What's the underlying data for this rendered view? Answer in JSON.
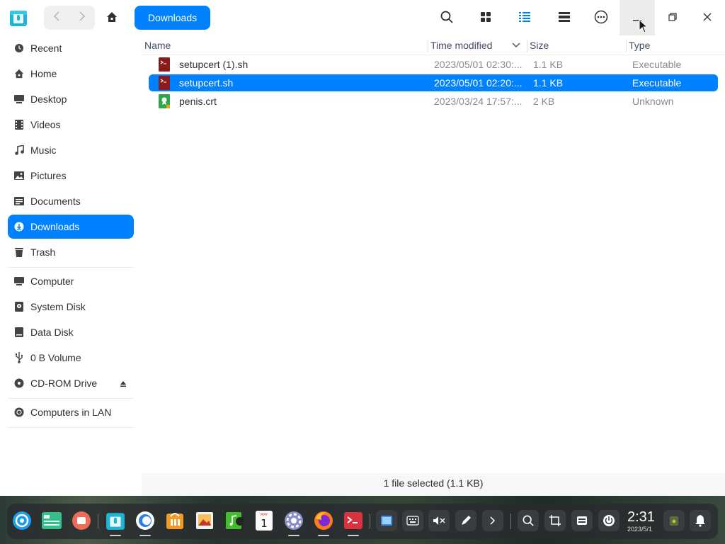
{
  "window": {
    "title_crumb": "Downloads",
    "icons": {
      "back": "chevron-left-icon",
      "forward": "chevron-right-icon",
      "home": "home-icon",
      "search": "search-icon",
      "icon_view": "grid-view-icon",
      "list_view": "list-view-icon",
      "detail_view": "detail-view-icon",
      "more": "more-icon",
      "minimize": "minimize-icon",
      "maximize": "maximize-icon",
      "close": "close-icon"
    }
  },
  "sidebar": {
    "items": [
      {
        "label": "Recent",
        "icon": "clock-icon"
      },
      {
        "label": "Home",
        "icon": "home-icon"
      },
      {
        "label": "Desktop",
        "icon": "desktop-icon"
      },
      {
        "label": "Videos",
        "icon": "video-icon"
      },
      {
        "label": "Music",
        "icon": "music-icon"
      },
      {
        "label": "Pictures",
        "icon": "picture-icon"
      },
      {
        "label": "Documents",
        "icon": "document-icon"
      },
      {
        "label": "Downloads",
        "icon": "download-icon",
        "active": true
      },
      {
        "label": "Trash",
        "icon": "trash-icon"
      }
    ],
    "devices": [
      {
        "label": "Computer",
        "icon": "computer-icon"
      },
      {
        "label": "System Disk",
        "icon": "disk-icon"
      },
      {
        "label": "Data Disk",
        "icon": "disk-icon"
      },
      {
        "label": "0 B Volume",
        "icon": "usb-icon"
      },
      {
        "label": "CD-ROM Drive",
        "icon": "cdrom-icon",
        "eject": true
      }
    ],
    "network": [
      {
        "label": "Computers in LAN",
        "icon": "network-icon"
      }
    ]
  },
  "file_list": {
    "columns": [
      "Name",
      "Time modified",
      "Size",
      "Type"
    ],
    "rows": [
      {
        "name": "setupcert (1).sh",
        "time": "2023/05/01 02:30:...",
        "size": "1.1 KB",
        "type": "Executable",
        "icon": "script-file-icon",
        "selected": false
      },
      {
        "name": "setupcert.sh",
        "time": "2023/05/01 02:20:...",
        "size": "1.1 KB",
        "type": "Executable",
        "icon": "script-file-icon",
        "selected": true
      },
      {
        "name": "penis.crt",
        "time": "2023/03/24 17:57:...",
        "size": "2 KB",
        "type": "Unknown",
        "icon": "certificate-file-icon",
        "selected": false
      }
    ]
  },
  "status_bar": {
    "text": "1 file selected (1.1 KB)"
  },
  "dock": {
    "apps": [
      "launcher-icon",
      "multitask-icon",
      "screen-record-icon",
      "file-manager-icon",
      "browser-icon",
      "app-store-icon",
      "image-viewer-icon",
      "music-player-icon",
      "calendar-icon",
      "settings-icon",
      "firefox-icon",
      "terminal-icon"
    ],
    "calendar_month": "MAY",
    "calendar_day": "1",
    "clock_time": "2:31",
    "clock_date": "2023/5/1"
  },
  "colors": {
    "accent": "#0081ff",
    "selected_text": "#ffffff"
  }
}
